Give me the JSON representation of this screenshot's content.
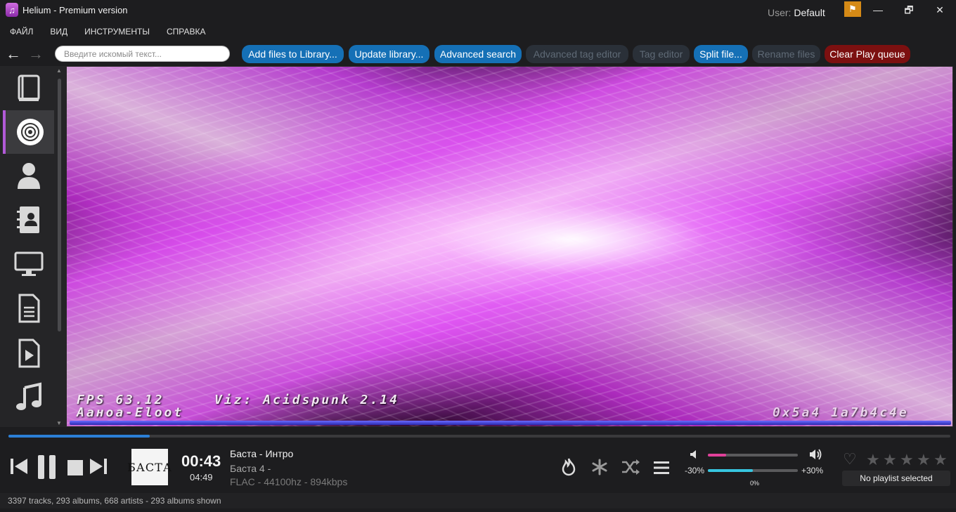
{
  "window": {
    "title": "Helium - Premium version",
    "user_label": "User:",
    "user_name": "Default",
    "minimize": "—",
    "restore": "🗗",
    "close": "✕"
  },
  "menu": {
    "items": [
      "ФАЙЛ",
      "ВИД",
      "ИНСТРУМЕНТЫ",
      "СПРАВКА"
    ]
  },
  "toolbar": {
    "back": "←",
    "forward": "→",
    "search_placeholder": "Введите искомый текст...",
    "buttons": [
      {
        "label": "Add files to Library...",
        "state": "active"
      },
      {
        "label": "Update library...",
        "state": "active"
      },
      {
        "label": "Advanced search",
        "state": "active"
      },
      {
        "label": "Advanced tag editor",
        "state": "disabled"
      },
      {
        "label": "Tag editor",
        "state": "disabled"
      },
      {
        "label": "Split file...",
        "state": "active"
      },
      {
        "label": "Rename files",
        "state": "disabled"
      },
      {
        "label": "Clear Play queue",
        "state": "danger"
      }
    ]
  },
  "sidebar": {
    "items": [
      {
        "icon": "book-icon",
        "selected": false
      },
      {
        "icon": "disc-icon",
        "selected": true
      },
      {
        "icon": "user-icon",
        "selected": false
      },
      {
        "icon": "contacts-icon",
        "selected": false
      },
      {
        "icon": "monitor-icon",
        "selected": false
      },
      {
        "icon": "document-icon",
        "selected": false
      },
      {
        "icon": "video-file-icon",
        "selected": false
      },
      {
        "icon": "music-note-icon",
        "selected": false
      }
    ]
  },
  "visualizer": {
    "fps_text": "FPS 63.12",
    "viz_text": "Viz: Acidspunk 2.14",
    "track_text": "Ааноа-Еloot",
    "code_text": "0x5a4  1a7b4c4e"
  },
  "player": {
    "progress": 0.15,
    "cover_text": "БАСТА",
    "time_current": "00:43",
    "time_total": "04:49",
    "track_title": "Баста - Интро",
    "track_album": "Баста 4 -",
    "track_format": "FLAC - 44100hz - 894kbps",
    "volume": 0.2,
    "tempo_min": "-30%",
    "tempo_max": "+30%",
    "tempo": 0.5,
    "tempo_value": "0%",
    "rating": 0,
    "playlist": "No playlist selected"
  },
  "status": {
    "text": "3397 tracks, 293 albums, 668 artists - 293 albums shown"
  },
  "colors": {
    "accent": "#1570b6",
    "danger": "#7c1010",
    "selected": "#b25ad8",
    "volume": "#e0409a",
    "tempo": "#37c6e0"
  }
}
